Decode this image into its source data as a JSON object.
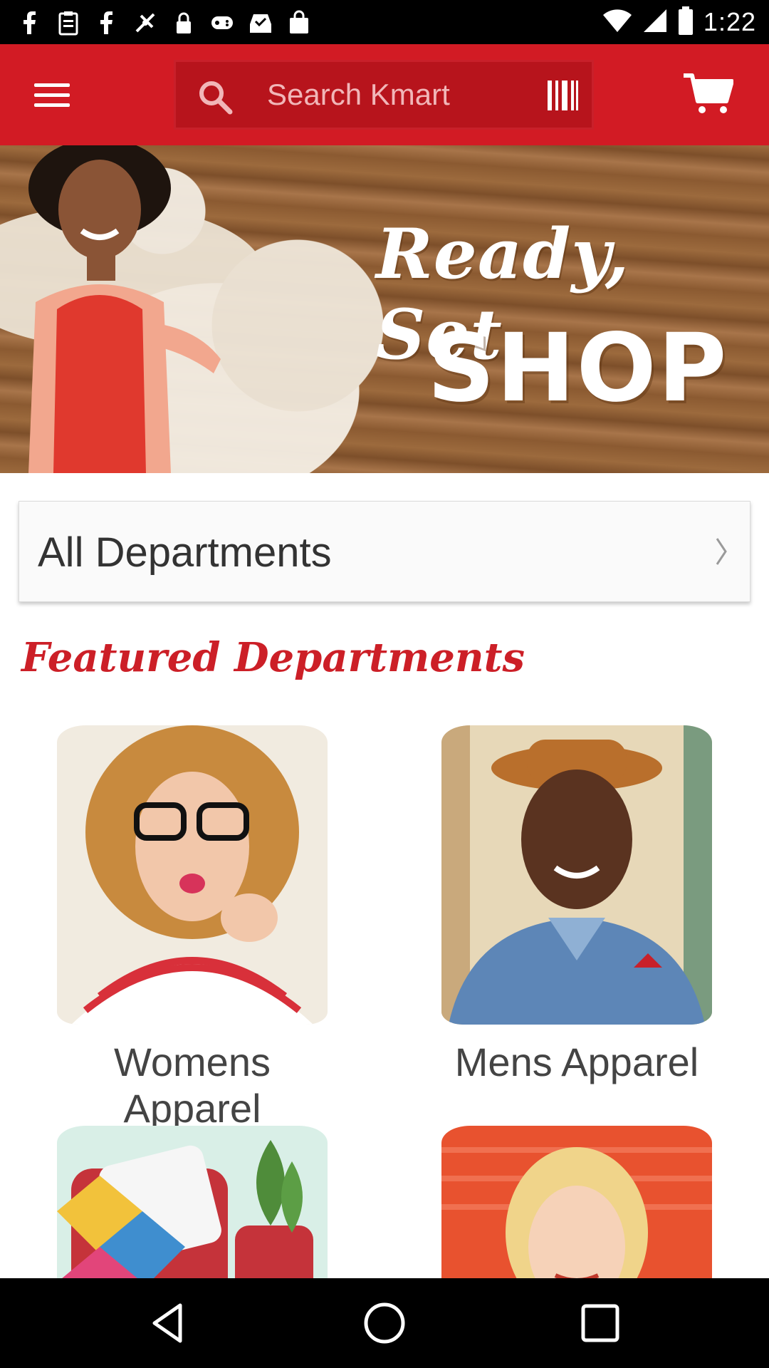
{
  "status_bar": {
    "time": "1:22",
    "left_icons": [
      "facebook-icon",
      "clipboard-icon",
      "facebook-icon",
      "fake-gps-icon",
      "lock-icon",
      "game-controller-icon",
      "inbox-check-icon",
      "shopping-bag-icon"
    ],
    "right_icons": [
      "wifi-icon",
      "signal-icon",
      "battery-icon"
    ]
  },
  "app_bar": {
    "search_placeholder": "Search Kmart",
    "menu_icon": "hamburger-menu-icon",
    "search_icon": "search-icon",
    "barcode_icon": "barcode-scanner-icon",
    "cart_icon": "cart-icon",
    "brand_color": "#d21b24"
  },
  "hero": {
    "title_line1": "Ready, Set",
    "title_line2": "SHOP"
  },
  "all_departments": {
    "label": "All Departments"
  },
  "featured": {
    "heading": "Featured Departments",
    "tiles": [
      {
        "label": "Womens Apparel"
      },
      {
        "label": "Mens Apparel"
      },
      {
        "label": ""
      },
      {
        "label": ""
      }
    ]
  },
  "nav_bar": {
    "icons": [
      "back-icon",
      "home-icon",
      "recents-icon"
    ]
  }
}
